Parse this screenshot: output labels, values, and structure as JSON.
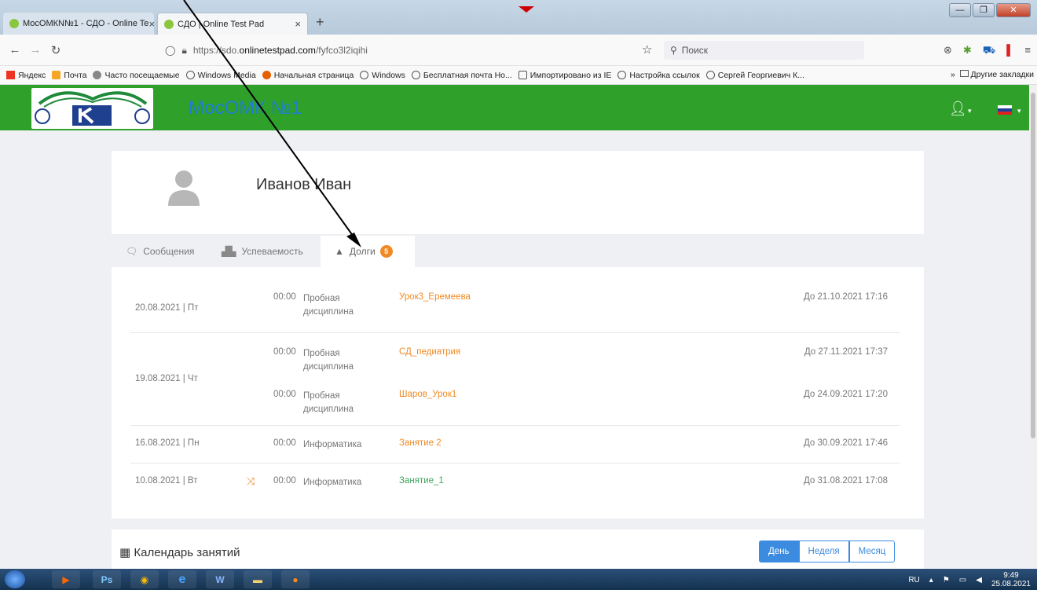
{
  "browser": {
    "tabs": [
      {
        "title": "МосОМКN№1 - СДО - Online Te"
      },
      {
        "title": "СДО | Online Test Pad"
      }
    ],
    "new_tab": "+",
    "close": "×",
    "url_prefix": "https://sdo.",
    "url_domain": "onlinetestpad.com",
    "url_path": "/fyfco3l2iqihi",
    "search_placeholder": "Поиск",
    "bookmarks": [
      "Яндекс",
      "Почта",
      "Часто посещаемые",
      "Windows Media",
      "Начальная страница",
      "Windows",
      "Бесплатная почта Ho...",
      "Импортировано из IE",
      "Настройка ссылок",
      "Сергей Георгиевич К..."
    ],
    "bookmarks_more": "Другие закладки"
  },
  "site": {
    "title": "МосОМК №1"
  },
  "profile": {
    "name": "Иванов Иван"
  },
  "tabs": [
    {
      "label": "Сообщения"
    },
    {
      "label": "Успеваемость"
    },
    {
      "label": "Долги",
      "badge": "5"
    }
  ],
  "debts": [
    {
      "date": "20.08.2021 | Пт",
      "items": [
        {
          "time": "00:00",
          "discipline": "Пробная дисциплина",
          "test": "Урок3_Еремеева",
          "due": "До 21.10.2021 17:16",
          "color": "orange"
        }
      ]
    },
    {
      "date": "19.08.2021 | Чт",
      "items": [
        {
          "time": "00:00",
          "discipline": "Пробная дисциплина",
          "test": "СД_педиатрия",
          "due": "До 27.11.2021 17:37",
          "color": "orange"
        },
        {
          "time": "00:00",
          "discipline": "Пробная дисциплина",
          "test": "Шаров_Урок1",
          "due": "До 24.09.2021 17:20",
          "color": "orange"
        }
      ]
    },
    {
      "date": "16.08.2021 | Пн",
      "items": [
        {
          "time": "00:00",
          "discipline": "Информатика",
          "test": "Занятие 2",
          "due": "До 30.09.2021 17:46",
          "color": "orange"
        }
      ]
    },
    {
      "date": "10.08.2021 | Вт",
      "items": [
        {
          "time": "00:00",
          "discipline": "Информатика",
          "test": "Занятие_1",
          "due": "До 31.08.2021 17:08",
          "color": "green",
          "shuffle": true
        }
      ]
    }
  ],
  "calendar": {
    "title": "Календарь занятий",
    "buttons": [
      "День",
      "Неделя",
      "Месяц"
    ],
    "active": "День"
  },
  "taskbar": {
    "lang": "RU",
    "time": "9:49",
    "date": "25.08.2021"
  },
  "colors": {
    "header_green": "#2fa12b",
    "accent_orange": "#f08a24",
    "accent_green": "#3da35a",
    "button_blue": "#3b8be0",
    "title_blue": "#1f7ed1"
  }
}
